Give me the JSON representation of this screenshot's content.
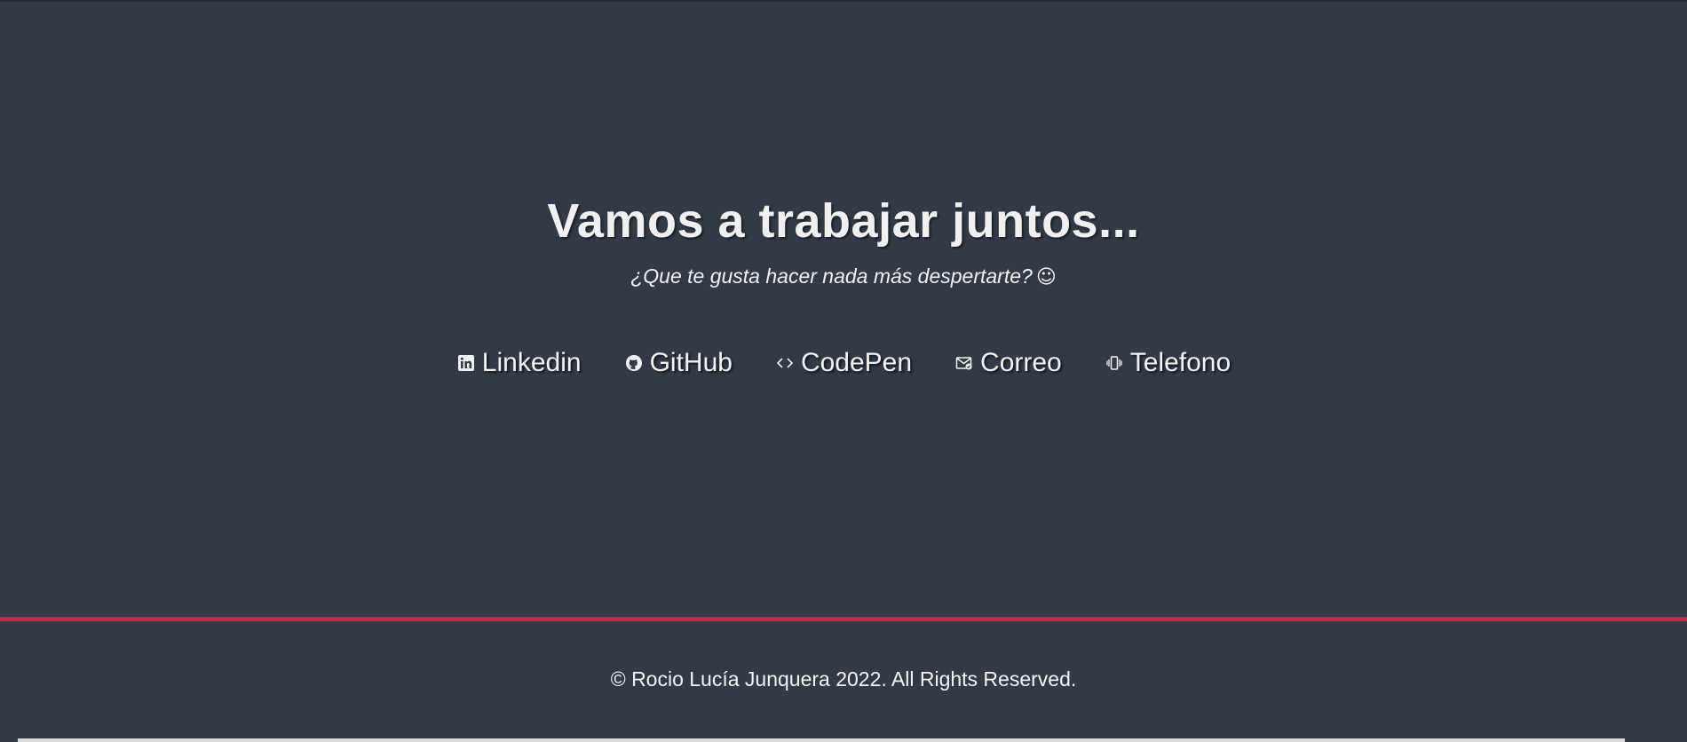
{
  "contact": {
    "title": "Vamos a trabajar juntos...",
    "subtitle": "¿Que te gusta hacer nada más despertarte?",
    "subtitle_emoji": "☺",
    "links": [
      {
        "label": "Linkedin",
        "icon": "linkedin-icon"
      },
      {
        "label": "GitHub",
        "icon": "github-icon"
      },
      {
        "label": "CodePen",
        "icon": "code-icon"
      },
      {
        "label": "Correo",
        "icon": "mail-icon"
      },
      {
        "label": "Telefono",
        "icon": "phone-vibrate-icon"
      }
    ]
  },
  "footer": {
    "copyright": "© Rocio Lucía Junquera 2022. All Rights Reserved."
  },
  "colors": {
    "background": "#333a45",
    "accent": "#c0304a",
    "text": "#f0f0f0"
  }
}
